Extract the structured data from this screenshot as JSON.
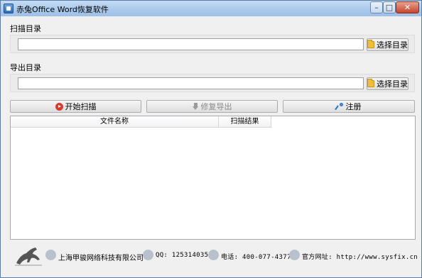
{
  "window": {
    "title": "赤兔Office Word恢复软件",
    "controls": {
      "minimize": "–",
      "maximize": "□",
      "close": "✕"
    }
  },
  "scan_section": {
    "label": "扫描目录",
    "path_value": "",
    "browse_label": "选择目录"
  },
  "export_section": {
    "label": "导出目录",
    "path_value": "",
    "browse_label": "选择目录"
  },
  "actions": {
    "start_scan": "开始扫描",
    "repair_export": "修复导出",
    "register": "注册"
  },
  "table": {
    "columns": [
      "文件名称",
      "扫描结果"
    ],
    "rows": []
  },
  "footer": {
    "company": "上海甲骏网络科技有限公司",
    "qq": "QQ: 1253140355",
    "phone": "电话: 400-077-4377",
    "website": "官方网址: http://www.sysfix.cn"
  },
  "icons": [
    "app-icon",
    "folder-icon",
    "play-icon",
    "down-arrow-icon",
    "key-icon",
    "building-icon",
    "qq-penguin-icon",
    "phone-icon",
    "globe-icon",
    "horse-logo"
  ]
}
